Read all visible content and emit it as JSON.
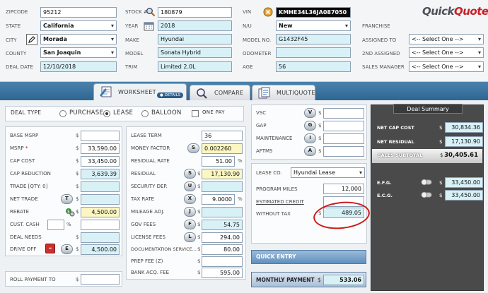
{
  "app": {
    "logo_prefix": "Quick",
    "logo_suffix": "Quote"
  },
  "header": {
    "zipcode_label": "ZIPCODE",
    "zipcode": "95212",
    "state_label": "STATE",
    "state": "California",
    "city_label": "CITY",
    "city": "Morada",
    "county_label": "COUNTY",
    "county": "San Joaquin",
    "deal_date_label": "DEAL DATE",
    "deal_date": "12/10/2018",
    "stock_label": "STOCK #",
    "stock": "180879",
    "year_label": "YEAR",
    "year": "2018",
    "make_label": "MAKE",
    "make": "Hyundai",
    "model_label": "MODEL",
    "model": "Sonata Hybrid",
    "trim_label": "TRIM",
    "trim": "Limited 2.0L",
    "vin_label": "VIN",
    "vin": "KMHE34L36JA087050",
    "nu_label": "N/U",
    "nu": "New",
    "model_no_label": "MODEL NO.",
    "model_no": "G1432F45",
    "odometer_label": "ODOMETER",
    "odometer": "",
    "age_label": "AGE",
    "age": "56",
    "franchise_label": "FRANCHISE",
    "assigned_to_label": "ASSIGNED TO",
    "assigned_to": "<-- Select One -->",
    "second_assigned_label": "2ND ASSIGNED",
    "second_assigned": "<-- Select One -->",
    "sales_manager_label": "SALES MANAGER",
    "sales_manager": "<-- Select One -->"
  },
  "tabs": [
    {
      "label": "WORKSHEET",
      "active": true
    },
    {
      "label": "COMPARE",
      "active": false
    },
    {
      "label": "MULTIQUOTE",
      "active": false
    }
  ],
  "details_label": "DETAILS",
  "deal_type": {
    "label": "DEAL TYPE",
    "options": [
      "PURCHASE",
      "LEASE",
      "BALLOON"
    ],
    "selected": "LEASE",
    "one_pay_label": "ONE PAY"
  },
  "left": {
    "base_msrp": {
      "label": "BASE MSRP",
      "value": ""
    },
    "msrp": {
      "label": "MSRP",
      "value": "33,590.00"
    },
    "cap_cost": {
      "label": "CAP COST",
      "value": "33,450.00"
    },
    "cap_reduction": {
      "label": "CAP REDUCTION",
      "value": "3,639.39"
    },
    "trade": {
      "label": "TRADE [QTY: 0]",
      "value": ""
    },
    "net_trade": {
      "label": "NET TRADE",
      "value": ""
    },
    "rebate": {
      "label": "REBATE",
      "value": "4,500.00"
    },
    "cust_cash": {
      "label": "CUST. CASH",
      "pct": "",
      "value": ""
    },
    "deal_needs": {
      "label": "DEAL NEEDS",
      "value": ""
    },
    "drive_off": {
      "label": "DRIVE OFF",
      "value": "4,500.00"
    },
    "roll_payment": {
      "label": "ROLL PAYMENT TO",
      "value": ""
    }
  },
  "middle": {
    "lease_term": {
      "label": "LEASE TERM",
      "value": "36"
    },
    "money_factor": {
      "label": "MONEY FACTOR",
      "value": "0.002260"
    },
    "residual_rate": {
      "label": "RESIDUAL RATE",
      "value": "51.00",
      "unit": "%"
    },
    "residual": {
      "label": "RESIDUAL",
      "value": "17,130.90"
    },
    "security_dep": {
      "label": "SECURITY DEP.",
      "value": ""
    },
    "tax_rate": {
      "label": "TAX RATE",
      "value": "9.0000",
      "unit": "%"
    },
    "mileage_adj": {
      "label": "MILEAGE ADJ.",
      "value": ""
    },
    "gov_fees": {
      "label": "GOV FEES",
      "value": "54.75"
    },
    "license_fees": {
      "label": "LICENSE FEES",
      "value": "294.00"
    },
    "doc_service": {
      "label": "DOCUMENTATION SERVICE...",
      "value": "80.00"
    },
    "prep_fee": {
      "label": "PREP FEE (Z)",
      "value": ""
    },
    "bank_acq": {
      "label": "BANK ACQ. FEE",
      "value": "595.00"
    }
  },
  "addons": [
    {
      "label": "VSC",
      "key": "V",
      "value": ""
    },
    {
      "label": "GAP",
      "key": "G",
      "value": ""
    },
    {
      "label": "MAINTENANCE",
      "key": "I",
      "value": ""
    },
    {
      "label": "AFTMS",
      "key": "A",
      "value": ""
    }
  ],
  "lease_co": {
    "label": "LEASE CO.",
    "value": "Hyundai Lease",
    "program_miles_label": "PROGRAM MILES",
    "program_miles": "12,000",
    "estimated_credit_label": "ESTIMATED CREDIT",
    "estimated_credit": "",
    "without_tax_label": "WITHOUT TAX",
    "without_tax": "489.05"
  },
  "quick_entry_label": "QUICK ENTRY",
  "monthly_payment": {
    "label": "MONTHLY PAYMENT",
    "value": "533.06"
  },
  "summary": {
    "title": "Deal Summary",
    "net_cap_cost": {
      "label": "NET CAP COST",
      "value": "30,834.36"
    },
    "net_residual": {
      "label": "NET RESIDUAL",
      "value": "17,130.90"
    },
    "sales_subtotal": {
      "label": "SALES SUBTOTAL",
      "value": "30,405.61"
    },
    "efg": {
      "label": "E.F.G.",
      "value": "33,450.00"
    },
    "ecg": {
      "label": "E.C.G.",
      "value": "33,450.00"
    }
  },
  "currency": "$",
  "colors": {
    "accent_blue": "#2e6692",
    "annotation_red": "#cc1b1b",
    "logo_red": "#c81f25"
  }
}
